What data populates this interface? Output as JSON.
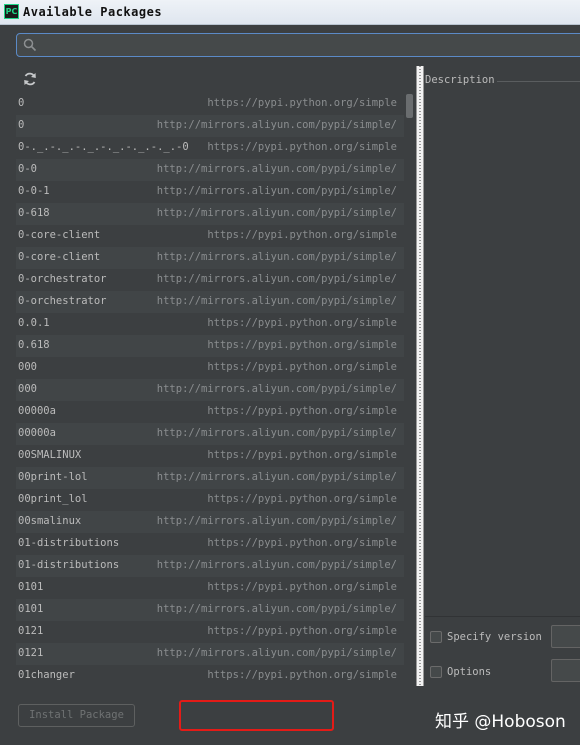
{
  "window": {
    "title": "Available Packages",
    "app_icon_text": "PC"
  },
  "search": {
    "value": "",
    "placeholder": ""
  },
  "packages": [
    {
      "name": "0",
      "repo": "https://pypi.python.org/simple"
    },
    {
      "name": "0",
      "repo": "http://mirrors.aliyun.com/pypi/simple/"
    },
    {
      "name": "0-._.-._.-._.-._.-._.-._.-0",
      "repo": "https://pypi.python.org/simple"
    },
    {
      "name": "0-0",
      "repo": "http://mirrors.aliyun.com/pypi/simple/"
    },
    {
      "name": "0-0-1",
      "repo": "http://mirrors.aliyun.com/pypi/simple/"
    },
    {
      "name": "0-618",
      "repo": "http://mirrors.aliyun.com/pypi/simple/"
    },
    {
      "name": "0-core-client",
      "repo": "https://pypi.python.org/simple"
    },
    {
      "name": "0-core-client",
      "repo": "http://mirrors.aliyun.com/pypi/simple/"
    },
    {
      "name": "0-orchestrator",
      "repo": "http://mirrors.aliyun.com/pypi/simple/"
    },
    {
      "name": "0-orchestrator",
      "repo": "http://mirrors.aliyun.com/pypi/simple/"
    },
    {
      "name": "0.0.1",
      "repo": "https://pypi.python.org/simple"
    },
    {
      "name": "0.618",
      "repo": "https://pypi.python.org/simple"
    },
    {
      "name": "000",
      "repo": "https://pypi.python.org/simple"
    },
    {
      "name": "000",
      "repo": "http://mirrors.aliyun.com/pypi/simple/"
    },
    {
      "name": "00000a",
      "repo": "https://pypi.python.org/simple"
    },
    {
      "name": "00000a",
      "repo": "http://mirrors.aliyun.com/pypi/simple/"
    },
    {
      "name": "00SMALINUX",
      "repo": "https://pypi.python.org/simple"
    },
    {
      "name": "00print-lol",
      "repo": "http://mirrors.aliyun.com/pypi/simple/"
    },
    {
      "name": "00print_lol",
      "repo": "https://pypi.python.org/simple"
    },
    {
      "name": "00smalinux",
      "repo": "http://mirrors.aliyun.com/pypi/simple/"
    },
    {
      "name": "01-distributions",
      "repo": "https://pypi.python.org/simple"
    },
    {
      "name": "01-distributions",
      "repo": "http://mirrors.aliyun.com/pypi/simple/"
    },
    {
      "name": "0101",
      "repo": "https://pypi.python.org/simple"
    },
    {
      "name": "0101",
      "repo": "http://mirrors.aliyun.com/pypi/simple/"
    },
    {
      "name": "0121",
      "repo": "https://pypi.python.org/simple"
    },
    {
      "name": "0121",
      "repo": "http://mirrors.aliyun.com/pypi/simple/"
    },
    {
      "name": "01changer",
      "repo": "https://pypi.python.org/simple"
    }
  ],
  "details": {
    "description_label": "Description",
    "specify_version_label": "Specify version",
    "specify_version_checked": false,
    "options_label": "Options",
    "options_checked": false
  },
  "footer": {
    "install_button": "Install Package"
  },
  "watermark": "知乎 @Hoboson",
  "colors": {
    "background": "#3c3f41",
    "row_alt": "#414547",
    "text": "#bbbbbb",
    "repo_text": "#8a8d8f",
    "search_border": "#5b8ac7",
    "highlight": "#e41b17"
  },
  "icons": {
    "search": "search-icon",
    "refresh": "refresh-icon"
  }
}
